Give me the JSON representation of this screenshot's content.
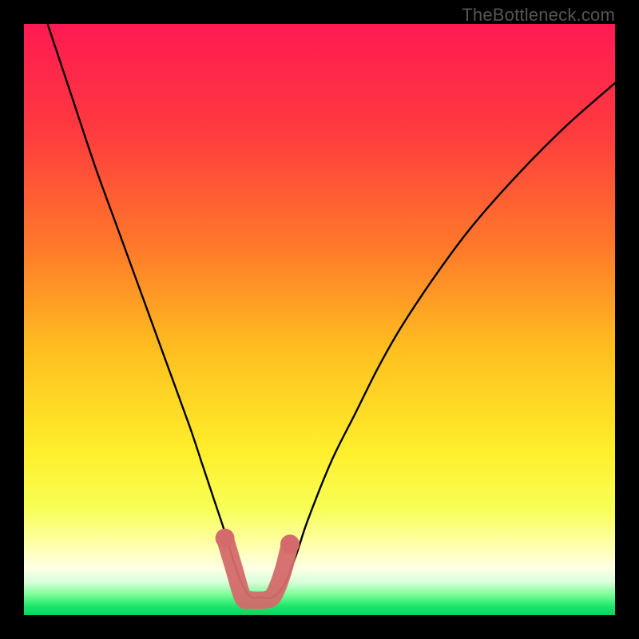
{
  "watermark": "TheBottleneck.com",
  "chart_data": {
    "type": "line",
    "title": "",
    "xlabel": "",
    "ylabel": "",
    "xlim": [
      0,
      100
    ],
    "ylim": [
      0,
      100
    ],
    "grid": false,
    "legend": false,
    "series": [
      {
        "name": "curve",
        "color": "#000000",
        "x": [
          4,
          8,
          12,
          16,
          20,
          24,
          28,
          30,
          32,
          34,
          35.5,
          37,
          38.5,
          40,
          42,
          44,
          46,
          48,
          52,
          56,
          60,
          64,
          70,
          76,
          84,
          92,
          100
        ],
        "y": [
          100,
          88,
          76,
          65,
          54,
          43,
          32,
          26,
          20,
          14,
          9,
          5,
          3,
          3,
          3,
          5,
          10,
          16,
          26,
          34,
          42,
          49,
          58,
          66,
          75,
          83,
          90
        ]
      },
      {
        "name": "marker-band",
        "color": "#d46a6a",
        "type": "scatter",
        "x": [
          34,
          35.5,
          37,
          38,
          39,
          40,
          41,
          42,
          43,
          44,
          45
        ],
        "y": [
          13,
          8,
          3,
          2.6,
          2.5,
          2.5,
          2.6,
          3,
          5,
          8,
          12
        ]
      }
    ],
    "background_gradient": {
      "stops": [
        {
          "offset": 0.0,
          "color": "#ff1a52"
        },
        {
          "offset": 0.18,
          "color": "#ff3a3f"
        },
        {
          "offset": 0.38,
          "color": "#ff7a2a"
        },
        {
          "offset": 0.55,
          "color": "#ffbe20"
        },
        {
          "offset": 0.72,
          "color": "#ffee2a"
        },
        {
          "offset": 0.82,
          "color": "#f7ff55"
        },
        {
          "offset": 0.88,
          "color": "#ffffa8"
        },
        {
          "offset": 0.92,
          "color": "#ffffe6"
        },
        {
          "offset": 0.945,
          "color": "#d8ffd8"
        },
        {
          "offset": 0.965,
          "color": "#7cff99"
        },
        {
          "offset": 0.985,
          "color": "#1de66a"
        },
        {
          "offset": 1.0,
          "color": "#0fd25c"
        }
      ]
    }
  }
}
